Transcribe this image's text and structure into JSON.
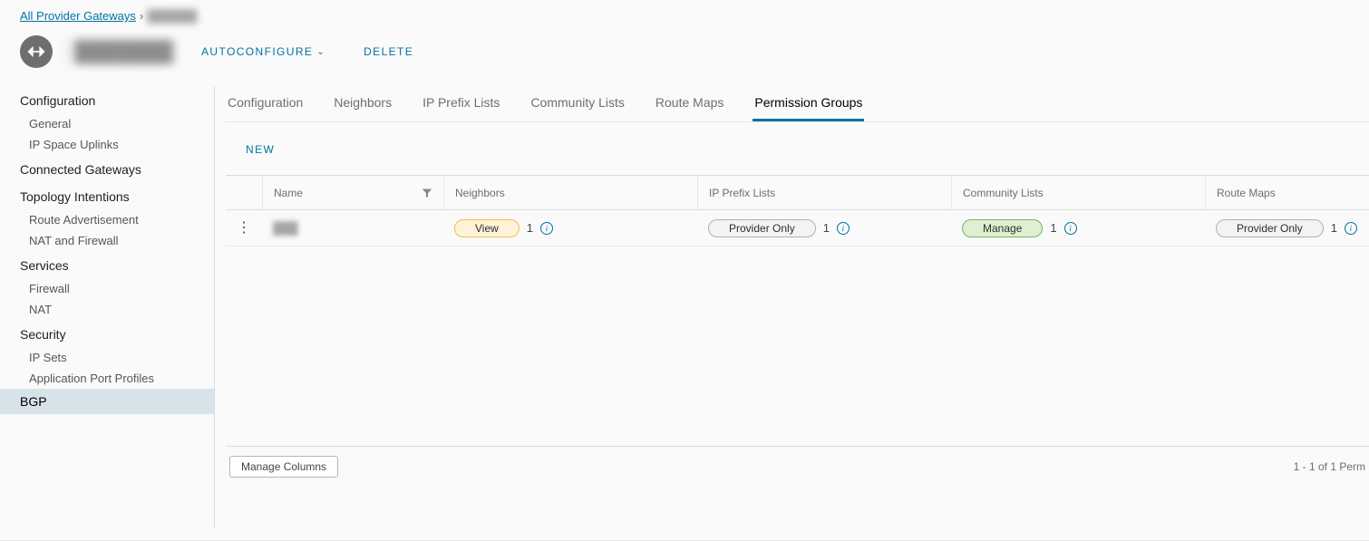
{
  "breadcrumb": {
    "root": "All Provider Gateways",
    "current": "██████"
  },
  "header": {
    "gateway_name": "███████",
    "actions": {
      "autoconfigure": "AUTOCONFIGURE",
      "delete": "DELETE"
    }
  },
  "sidebar": {
    "groups": [
      {
        "label": "Configuration",
        "items": [
          "General",
          "IP Space Uplinks"
        ]
      },
      {
        "label": "Connected Gateways",
        "items": []
      },
      {
        "label": "Topology Intentions",
        "items": [
          "Route Advertisement",
          "NAT and Firewall"
        ]
      },
      {
        "label": "Services",
        "items": [
          "Firewall",
          "NAT"
        ]
      },
      {
        "label": "Security",
        "items": [
          "IP Sets",
          "Application Port Profiles"
        ]
      }
    ],
    "active": "BGP"
  },
  "tabs": {
    "items": [
      "Configuration",
      "Neighbors",
      "IP Prefix Lists",
      "Community Lists",
      "Route Maps",
      "Permission Groups"
    ],
    "active_index": 5
  },
  "toolbar": {
    "new": "NEW"
  },
  "grid": {
    "columns": [
      "",
      "Name",
      "Neighbors",
      "IP Prefix Lists",
      "Community Lists",
      "Route Maps"
    ],
    "rows": [
      {
        "name": "███",
        "cells": [
          {
            "pill": "View",
            "style": "yellow",
            "count": "1"
          },
          {
            "pill": "Provider Only",
            "style": "grey",
            "count": "1"
          },
          {
            "pill": "Manage",
            "style": "green",
            "count": "1"
          },
          {
            "pill": "Provider Only",
            "style": "grey",
            "count": "1"
          }
        ]
      }
    ],
    "footer": {
      "manage_columns": "Manage Columns",
      "pager": "1 - 1 of 1 Perm"
    }
  }
}
